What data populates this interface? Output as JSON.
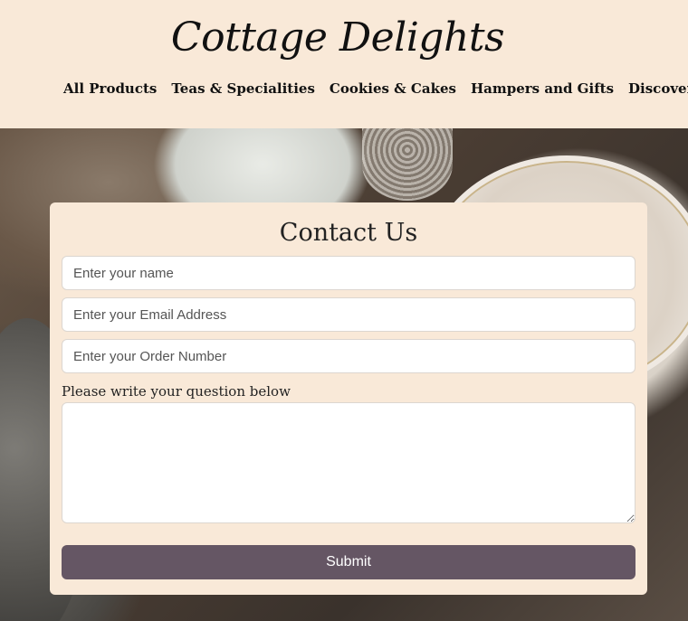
{
  "header": {
    "brand": "Cottage Delights",
    "nav": [
      {
        "label": "All Products"
      },
      {
        "label": "Teas & Specialities"
      },
      {
        "label": "Cookies & Cakes"
      },
      {
        "label": "Hampers and Gifts"
      },
      {
        "label": "Discover"
      }
    ],
    "background_color": "#f9e9d8"
  },
  "contact": {
    "title": "Contact Us",
    "name_placeholder": "Enter your name",
    "email_placeholder": "Enter your Email Address",
    "order_placeholder": "Enter your Order Number",
    "question_label": "Please write your question below",
    "submit_label": "Submit",
    "submit_color": "#655664"
  }
}
